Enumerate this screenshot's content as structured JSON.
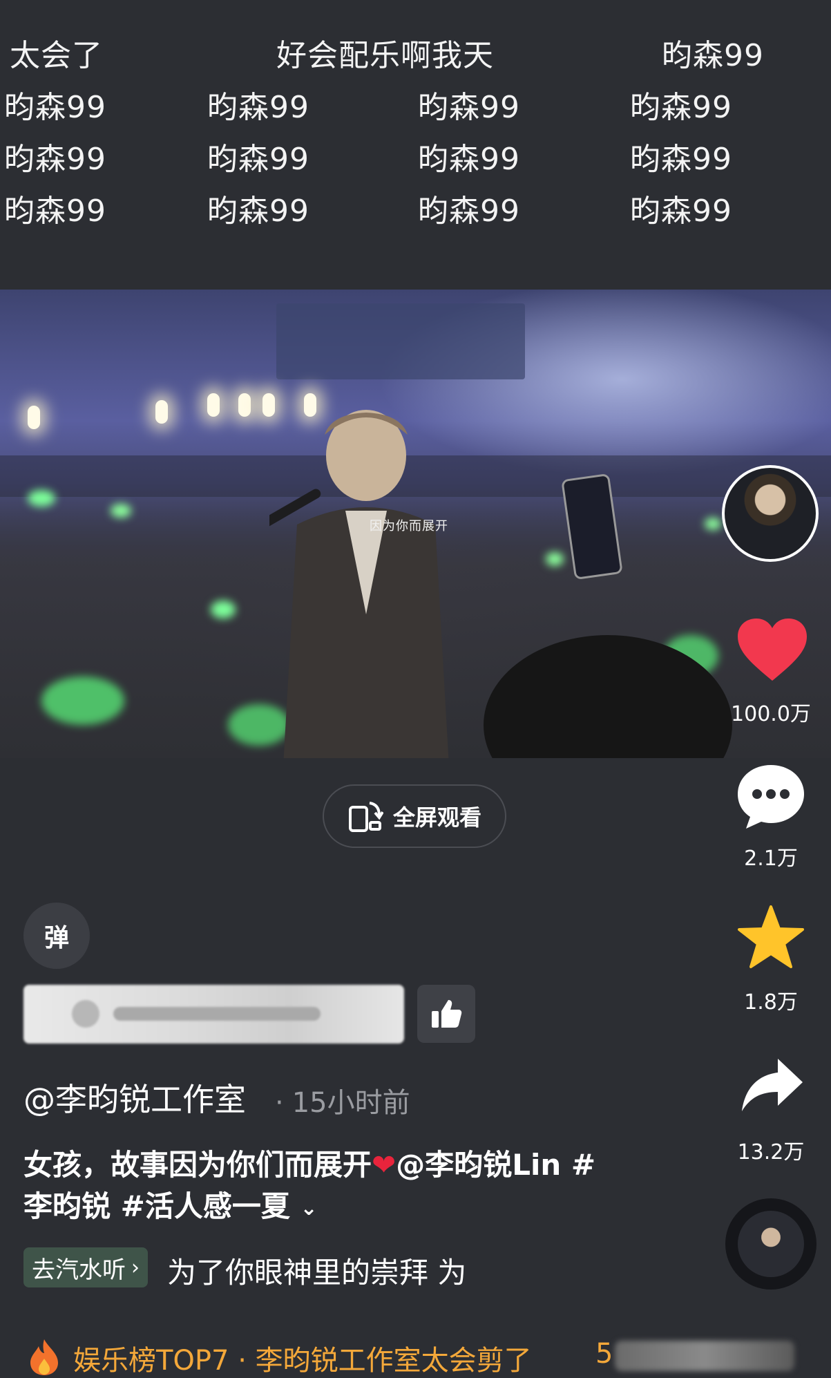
{
  "danmaku": {
    "row1": [
      "太会了",
      "好会配乐啊我天",
      "昀森99"
    ],
    "row2": [
      "昀森99",
      "昀森99",
      "昀森99",
      "昀森99"
    ],
    "row3": [
      "昀森99",
      "昀森99",
      "昀森99",
      "昀森99"
    ],
    "row4": [
      "昀森99",
      "昀森99",
      "昀森99",
      "昀森99"
    ]
  },
  "video": {
    "subtitle": "因为你而展开"
  },
  "fullscreen": {
    "label": "全屏观看"
  },
  "rail": {
    "likes": "100.0万",
    "comments": "2.1万",
    "favorites": "1.8万",
    "shares": "13.2万",
    "colors": {
      "like": "#f2384e",
      "favorite": "#ffc42a"
    }
  },
  "danmaku_toggle": {
    "label": "弹"
  },
  "post": {
    "author": "@李昀锐工作室",
    "time_ago": "15小时前",
    "description_line1": "女孩，故事因为你们而展开",
    "mention": "@李昀锐Lin #",
    "description_line2": "李昀锐 #活人感一夏"
  },
  "music": {
    "tag_label": "去汽水听",
    "lyric": "为了你眼神里的崇拜  为"
  },
  "ranking": {
    "text": "娱乐榜TOP7 · 李昀锐工作室太会剪了",
    "number": "5"
  }
}
